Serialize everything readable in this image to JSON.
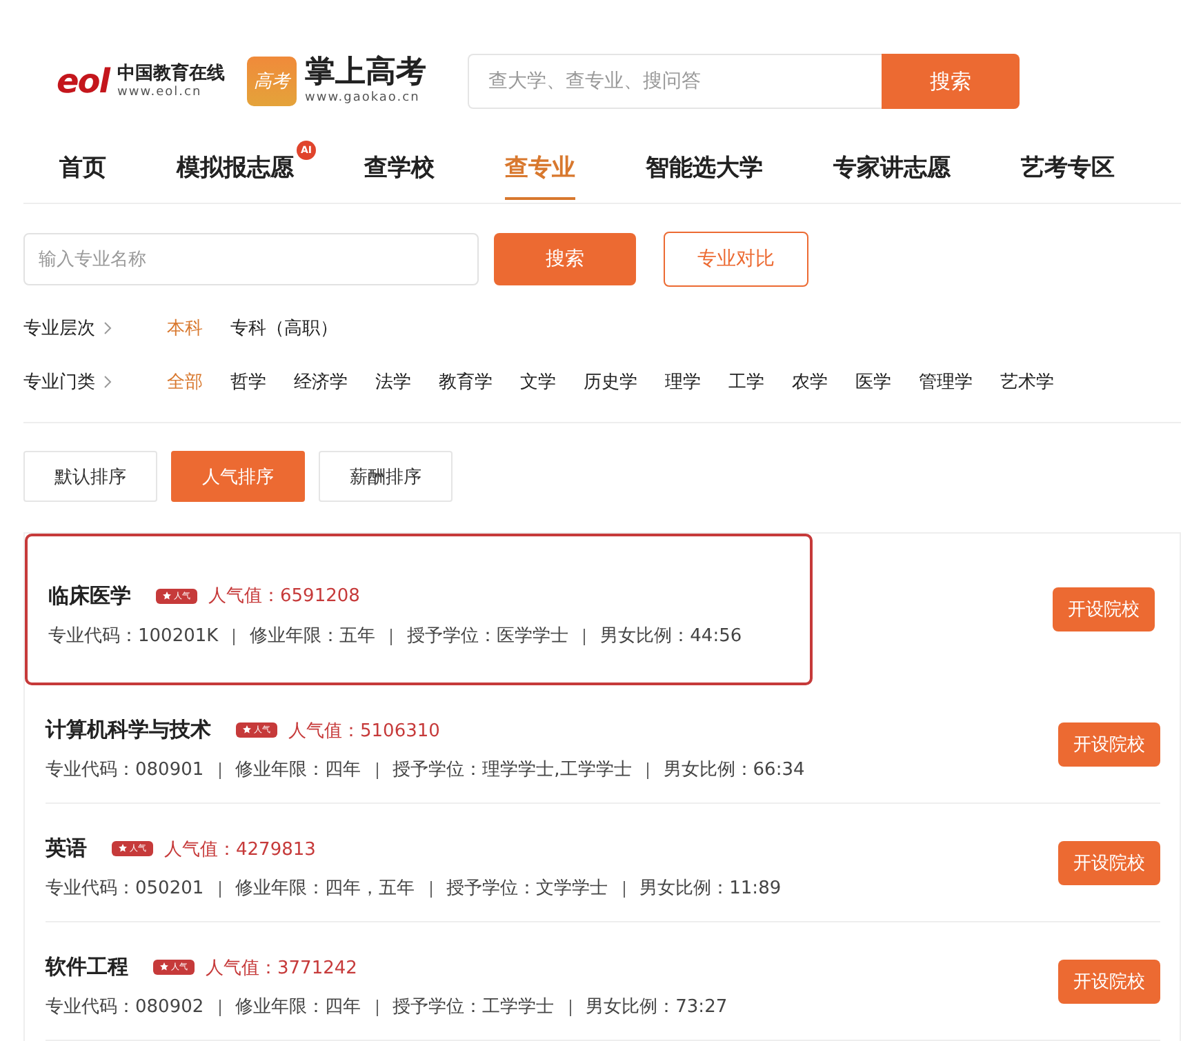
{
  "header": {
    "eol_logo": {
      "mark": "eol",
      "name": "中国教育在线",
      "url": "www.eol.cn"
    },
    "gaokao_logo": {
      "mark": "高考",
      "name": "掌上高考",
      "url": "www.gaokao.cn"
    },
    "search": {
      "placeholder": "查大学、查专业、搜问答",
      "button": "搜索"
    }
  },
  "nav": [
    {
      "label": "首页",
      "selected": false
    },
    {
      "label": "模拟报志愿",
      "selected": false,
      "badge": "AI"
    },
    {
      "label": "查学校",
      "selected": false
    },
    {
      "label": "查专业",
      "selected": true
    },
    {
      "label": "智能选大学",
      "selected": false
    },
    {
      "label": "专家讲志愿",
      "selected": false
    },
    {
      "label": "艺考专区",
      "selected": false
    }
  ],
  "major_search": {
    "placeholder": "输入专业名称",
    "button": "搜索",
    "compare_button": "专业对比"
  },
  "filters": [
    {
      "label": "专业层次",
      "options": [
        {
          "label": "本科",
          "selected": true
        },
        {
          "label": "专科（高职）",
          "selected": false
        }
      ]
    },
    {
      "label": "专业门类",
      "options": [
        {
          "label": "全部",
          "selected": true
        },
        {
          "label": "哲学",
          "selected": false
        },
        {
          "label": "经济学",
          "selected": false
        },
        {
          "label": "法学",
          "selected": false
        },
        {
          "label": "教育学",
          "selected": false
        },
        {
          "label": "文学",
          "selected": false
        },
        {
          "label": "历史学",
          "selected": false
        },
        {
          "label": "理学",
          "selected": false
        },
        {
          "label": "工学",
          "selected": false
        },
        {
          "label": "农学",
          "selected": false
        },
        {
          "label": "医学",
          "selected": false
        },
        {
          "label": "管理学",
          "selected": false
        },
        {
          "label": "艺术学",
          "selected": false
        }
      ]
    }
  ],
  "sort_tabs": [
    {
      "label": "默认排序",
      "selected": false
    },
    {
      "label": "人气排序",
      "selected": true
    },
    {
      "label": "薪酬排序",
      "selected": false
    }
  ],
  "majors": [
    {
      "name": "临床医学",
      "badge": "人气",
      "popularity": "人气值：6591208",
      "fields": [
        "专业代码：100201K",
        "修业年限：五年",
        "授予学位：医学学士",
        "男女比例：44:56"
      ],
      "button": "开设院校",
      "highlighted": true
    },
    {
      "name": "计算机科学与技术",
      "badge": "人气",
      "popularity": "人气值：5106310",
      "fields": [
        "专业代码：080901",
        "修业年限：四年",
        "授予学位：理学学士,工学学士",
        "男女比例：66:34"
      ],
      "button": "开设院校",
      "highlighted": false
    },
    {
      "name": "英语",
      "badge": "人气",
      "popularity": "人气值：4279813",
      "fields": [
        "专业代码：050201",
        "修业年限：四年，五年",
        "授予学位：文学学士",
        "男女比例：11:89"
      ],
      "button": "开设院校",
      "highlighted": false
    },
    {
      "name": "软件工程",
      "badge": "人气",
      "popularity": "人气值：3771242",
      "fields": [
        "专业代码：080902",
        "修业年限：四年",
        "授予学位：工学学士",
        "男女比例：73:27"
      ],
      "button": "开设院校",
      "highlighted": false
    }
  ]
}
